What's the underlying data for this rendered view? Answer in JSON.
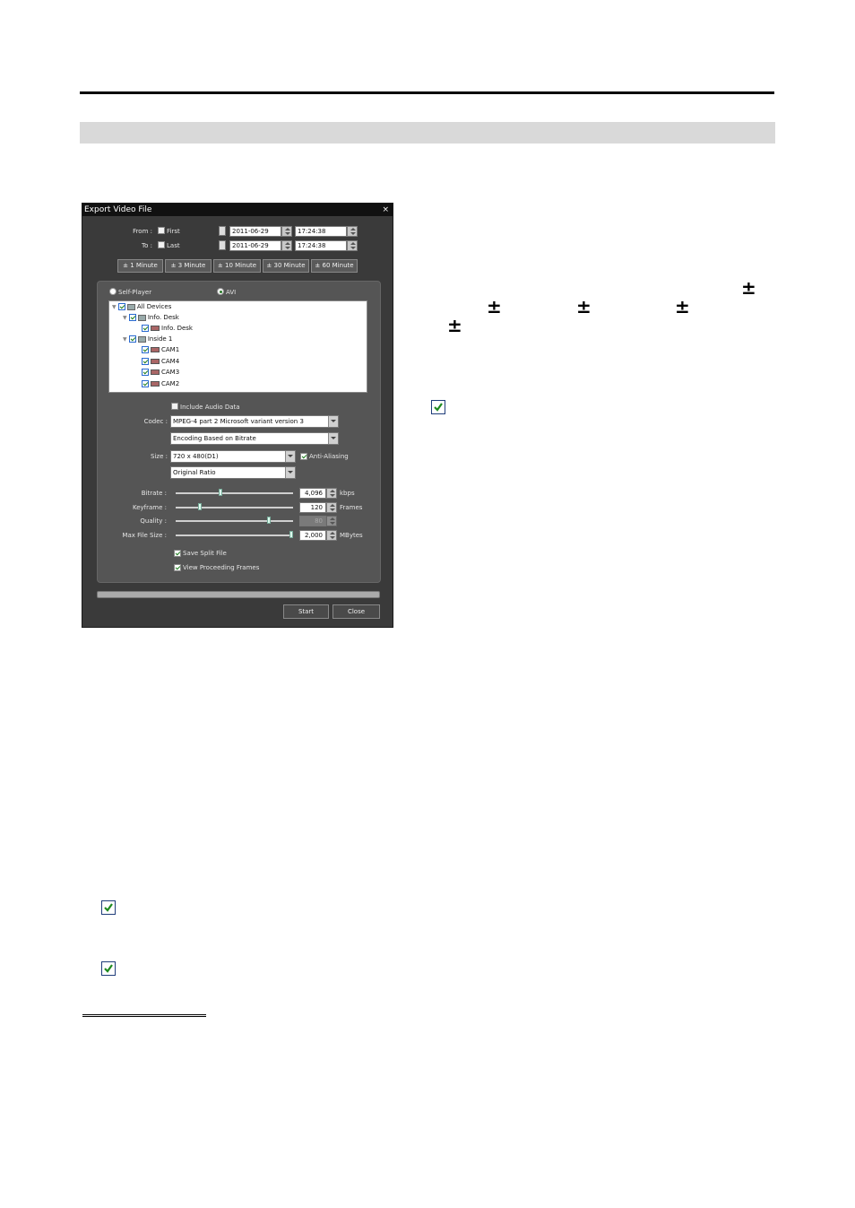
{
  "dialog": {
    "title": "Export Video File",
    "close_glyph": "×",
    "from": {
      "label": "From :",
      "check_label": "First",
      "date": "2011-06-29",
      "time": "17:24:38"
    },
    "to": {
      "label": "To :",
      "check_label": "Last",
      "date": "2011-06-29",
      "time": "17:24:38"
    },
    "time_buttons": [
      "± 1 Minute",
      "± 3 Minute",
      "± 10 Minute",
      "± 30 Minute",
      "± 60 Minute"
    ],
    "format": {
      "self_player": "Self-Player",
      "avi": "AVI",
      "selected": "AVI"
    },
    "tree": [
      {
        "label": "All Devices",
        "level": 0,
        "kind": "group"
      },
      {
        "label": "Info. Desk",
        "level": 1,
        "kind": "group"
      },
      {
        "label": "Info. Desk",
        "level": 2,
        "kind": "camera"
      },
      {
        "label": "Inside 1",
        "level": 1,
        "kind": "group"
      },
      {
        "label": "CAM1",
        "level": 2,
        "kind": "camera"
      },
      {
        "label": "CAM4",
        "level": 2,
        "kind": "camera"
      },
      {
        "label": "CAM3",
        "level": 2,
        "kind": "camera"
      },
      {
        "label": "CAM2",
        "level": 2,
        "kind": "camera"
      }
    ],
    "include_audio": "Include Audio Data",
    "codec_label": "Codec :",
    "codec_value": "MPEG-4 part 2 Microsoft variant version 3",
    "encoding_value": "Encoding Based on Bitrate",
    "size_label": "Size :",
    "size_value": "720 x 480(D1)",
    "anti_aliasing": "Anti-Aliasing",
    "ratio_value": "Original Ratio",
    "sliders": [
      {
        "label": "Bitrate :",
        "value": "4,096",
        "unit": "kbps",
        "level": 0.38,
        "enabled": true
      },
      {
        "label": "Keyframe :",
        "value": "120",
        "unit": "Frames",
        "level": 0.2,
        "enabled": true
      },
      {
        "label": "Quality :",
        "value": "80",
        "unit": "",
        "level": 0.8,
        "enabled": false
      },
      {
        "label": "Max File Size :",
        "value": "2,000",
        "unit": "MBytes",
        "level": 1.0,
        "enabled": true
      }
    ],
    "save_split": "Save Split File",
    "view_proceeding": "View Proceeding Frames",
    "start": "Start",
    "close": "Close"
  },
  "page": {
    "plus_minus": "±"
  }
}
